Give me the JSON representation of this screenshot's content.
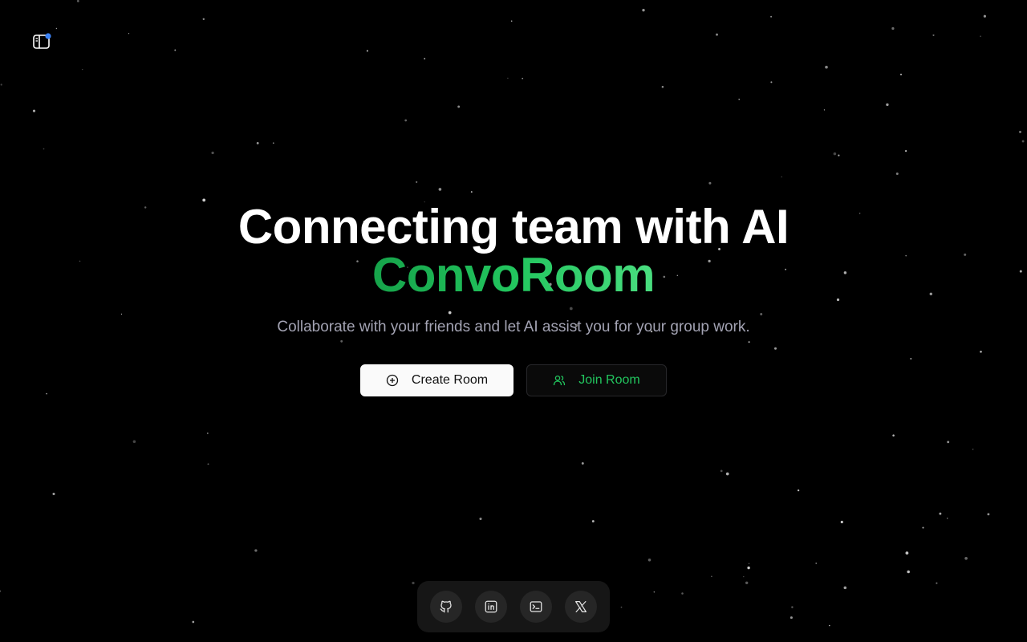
{
  "hero": {
    "headline": "Connecting team with AI",
    "brand": "ConvoRoom",
    "tagline": "Collaborate with your friends and let AI assist you for your group work."
  },
  "actions": {
    "create_label": "Create Room",
    "join_label": "Join Room"
  },
  "header": {
    "logo_icon": "sidebar-panel-icon",
    "notification_dot_color": "#3b82f6"
  },
  "dock": {
    "items": [
      {
        "icon": "github-icon"
      },
      {
        "icon": "linkedin-icon"
      },
      {
        "icon": "terminal-icon"
      },
      {
        "icon": "x-twitter-icon"
      }
    ]
  },
  "colors": {
    "background": "#000000",
    "brand_green": "#22c55e",
    "tagline": "#a3a3b3",
    "create_bg": "#fafafa",
    "join_bg": "#0a0a0a"
  }
}
